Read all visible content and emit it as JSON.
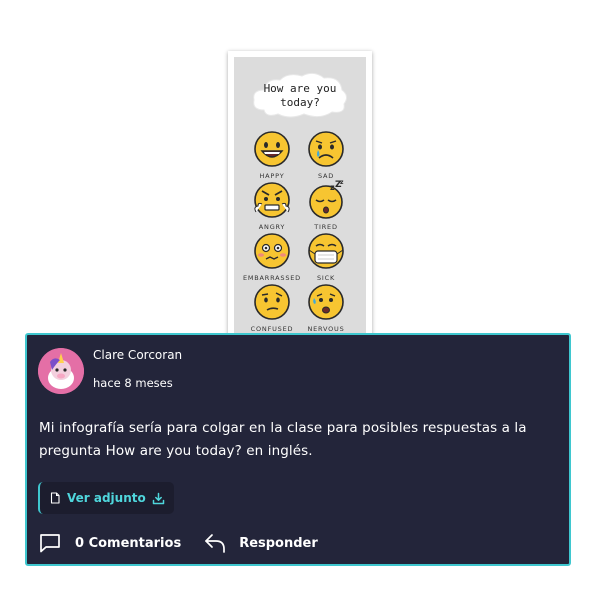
{
  "poster": {
    "title": "How are you today?",
    "emotions": [
      {
        "label": "HAPPY",
        "icon": "happy-face-icon"
      },
      {
        "label": "SAD",
        "icon": "sad-face-icon"
      },
      {
        "label": "ANGRY",
        "icon": "angry-face-icon"
      },
      {
        "label": "TIRED",
        "icon": "tired-face-icon"
      },
      {
        "label": "EMBARRASSED",
        "icon": "embarrassed-face-icon"
      },
      {
        "label": "SICK",
        "icon": "sick-face-icon"
      },
      {
        "label": "CONFUSED",
        "icon": "confused-face-icon"
      },
      {
        "label": "NERVOUS",
        "icon": "nervous-face-icon"
      }
    ]
  },
  "comment": {
    "author": "Clare Corcoran",
    "time": "hace 8 meses",
    "text": "Mi infografía sería para colgar en la clase para posibles respuestas a la pregunta How are you today? en inglés.",
    "attachment_label": "Ver adjunto",
    "comments_label": "0 Comentarios",
    "reply_label": "Responder"
  },
  "colors": {
    "card_background": "#23253a",
    "card_border": "#3fc7cf",
    "accent": "#4fd6dc",
    "emoji_yellow": "#f7c531"
  }
}
